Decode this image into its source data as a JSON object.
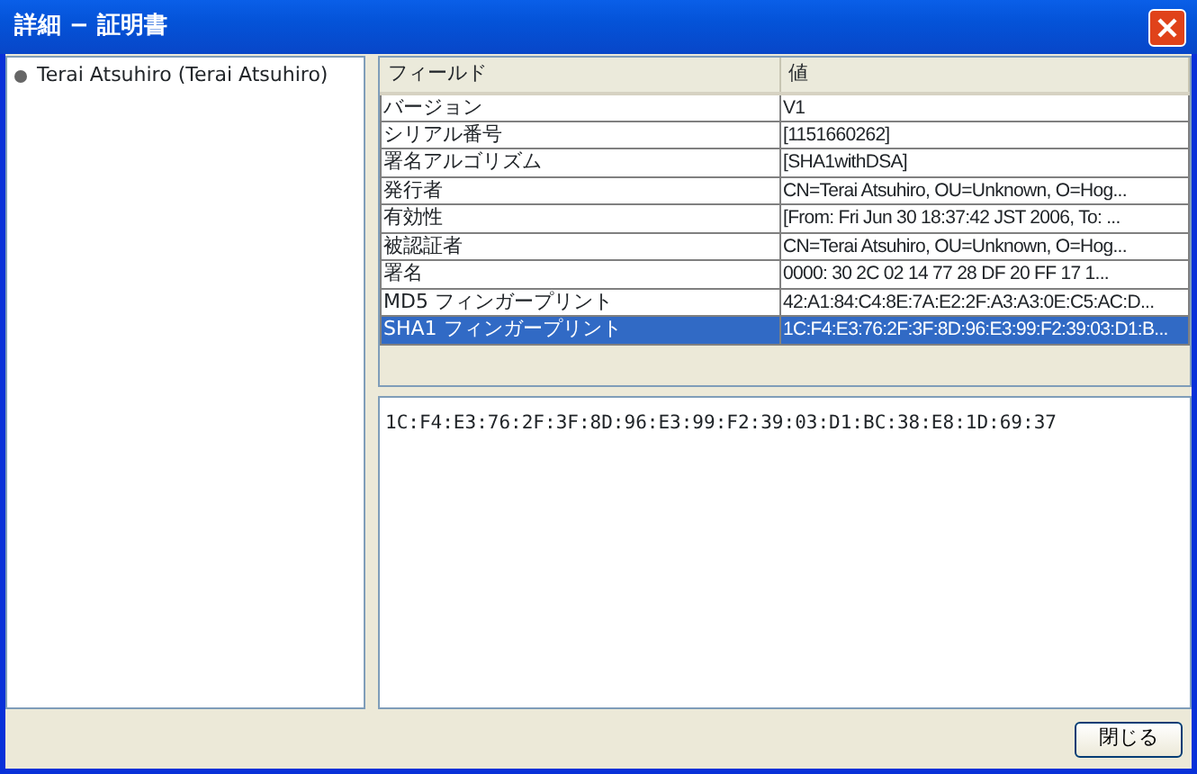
{
  "window": {
    "title": "詳細 − 証明書"
  },
  "tree": {
    "items": [
      {
        "label": "Terai Atsuhiro (Terai Atsuhiro)",
        "selected": false
      }
    ]
  },
  "table": {
    "columns": [
      "フィールド",
      "値"
    ],
    "rows": [
      {
        "field": "バージョン",
        "value": "V1",
        "selected": false
      },
      {
        "field": "シリアル番号",
        "value": "[1151660262]",
        "selected": false
      },
      {
        "field": "署名アルゴリズム",
        "value": "[SHA1withDSA]",
        "selected": false
      },
      {
        "field": "発行者",
        "value": "CN=Terai Atsuhiro, OU=Unknown, O=Hog...",
        "selected": false
      },
      {
        "field": "有効性",
        "value": "[From: Fri Jun 30 18:37:42 JST 2006, To: ...",
        "selected": false
      },
      {
        "field": "被認証者",
        "value": "CN=Terai Atsuhiro, OU=Unknown, O=Hog...",
        "selected": false
      },
      {
        "field": "署名",
        "value": "0000: 30 2C 02 14 77 28 DF 20    FF 17 1...",
        "selected": false
      },
      {
        "field": "MD5 フィンガープリント",
        "value": "42:A1:84:C4:8E:7A:E2:2F:A3:A3:0E:C5:AC:D...",
        "selected": false
      },
      {
        "field": "SHA1 フィンガープリント",
        "value": "1C:F4:E3:76:2F:3F:8D:96:E3:99:F2:39:03:D1:B...",
        "selected": true
      }
    ]
  },
  "detail": {
    "value": "1C:F4:E3:76:2F:3F:8D:96:E3:99:F2:39:03:D1:BC:38:E8:1D:69:37"
  },
  "buttons": [
    "閉じる"
  ]
}
